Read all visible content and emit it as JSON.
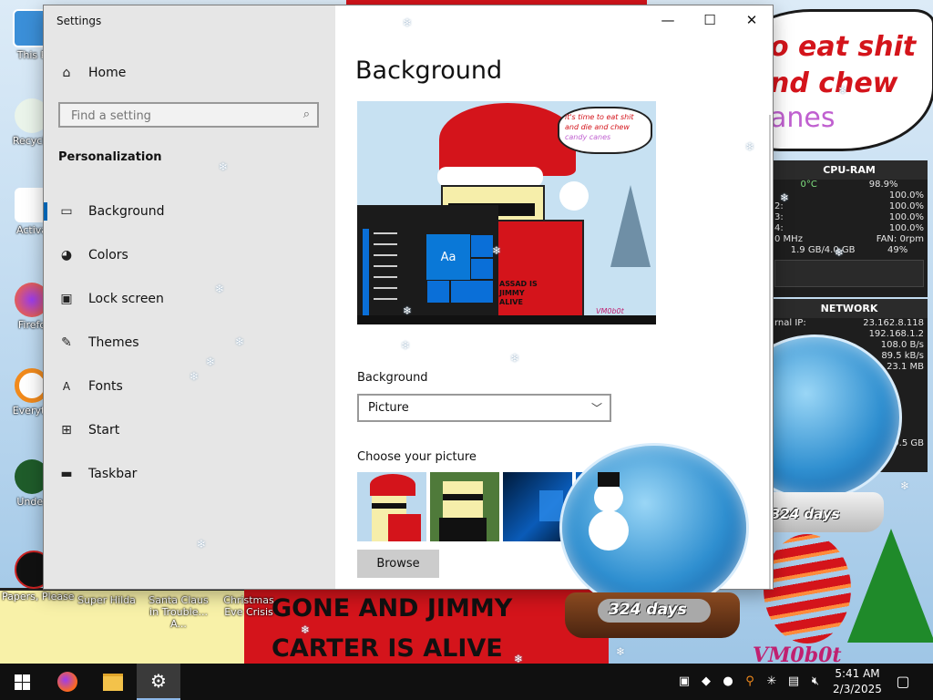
{
  "window": {
    "title": "Settings",
    "controls": {
      "minimize": "—",
      "maximize": "☐",
      "close": "✕"
    }
  },
  "sidebar": {
    "home_label": "Home",
    "search_placeholder": "Find a setting",
    "section_title": "Personalization",
    "items": [
      {
        "label": "Background",
        "icon": "picture-icon",
        "selected": true
      },
      {
        "label": "Colors",
        "icon": "palette-icon",
        "selected": false
      },
      {
        "label": "Lock screen",
        "icon": "lock-screen-icon",
        "selected": false
      },
      {
        "label": "Themes",
        "icon": "brush-icon",
        "selected": false
      },
      {
        "label": "Fonts",
        "icon": "font-icon",
        "selected": false
      },
      {
        "label": "Start",
        "icon": "start-icon",
        "selected": false
      },
      {
        "label": "Taskbar",
        "icon": "taskbar-icon",
        "selected": false
      }
    ]
  },
  "main": {
    "page_title": "Background",
    "preview": {
      "bubble_lines": [
        "it's time to eat shit",
        "and die and chew"
      ],
      "bubble_line_colored": "candy canes",
      "tile_label": "Aa",
      "shirt_text": [
        "ASSAD IS",
        "JIMMY",
        "ALIVE"
      ],
      "watermark": "VM0b0t"
    },
    "background_label": "Background",
    "background_value": "Picture",
    "choose_picture_label": "Choose your picture",
    "browse_label": "Browse"
  },
  "desktop": {
    "icons": [
      {
        "label": "This P"
      },
      {
        "label": "Recycle"
      },
      {
        "label": "Activa"
      },
      {
        "label": "Firefo"
      },
      {
        "label": "Everyth"
      },
      {
        "label": "Under"
      },
      {
        "label": "Papers, Please"
      },
      {
        "label": "Super Hilda"
      },
      {
        "label": "Santa Claus in Trouble... A..."
      },
      {
        "label": "Christmas Eve Crisis"
      }
    ],
    "wallpaper_bubble": [
      "o eat shit",
      "nd chew",
      "anes"
    ],
    "banner": [
      "GONE AND JIMMY",
      "CARTER IS ALIVE"
    ],
    "watermark": "VM0b0t"
  },
  "gadgets": {
    "cpu": {
      "title": "CPU-RAM",
      "temp": "0°C",
      "total": "98.9%",
      "cores": [
        {
          "label": "",
          "value": "100.0%"
        },
        {
          "label": "2:",
          "value": "100.0%"
        },
        {
          "label": "3:",
          "value": "100.0%"
        },
        {
          "label": "4:",
          "value": "100.0%"
        }
      ],
      "freq": "0 MHz",
      "fan": "FAN: 0rpm",
      "ram": "1.9 GB/4.0 GB",
      "ram_pct": "49%"
    },
    "network": {
      "title": "NETWORK",
      "rows": [
        {
          "label": "rnal IP:",
          "value": "23.162.8.118"
        },
        {
          "label": "",
          "value": "192.168.1.2"
        },
        {
          "label": "",
          "value": "108.0 B/s"
        },
        {
          "label": "",
          "value": "89.5 kB/s"
        },
        {
          "label": "",
          "value": "23.1 MB"
        }
      ],
      "extra": "9.5 GB"
    },
    "globe_large_label": "324 days",
    "globe_small_label": "324 days"
  },
  "taskbar": {
    "time": "5:41 AM",
    "date": "2/3/2025"
  },
  "colors": {
    "accent": "#0063b1",
    "sidebar_bg": "#e6e6e6",
    "taskbar_bg": "#101010",
    "santa_red": "#d4141b"
  }
}
